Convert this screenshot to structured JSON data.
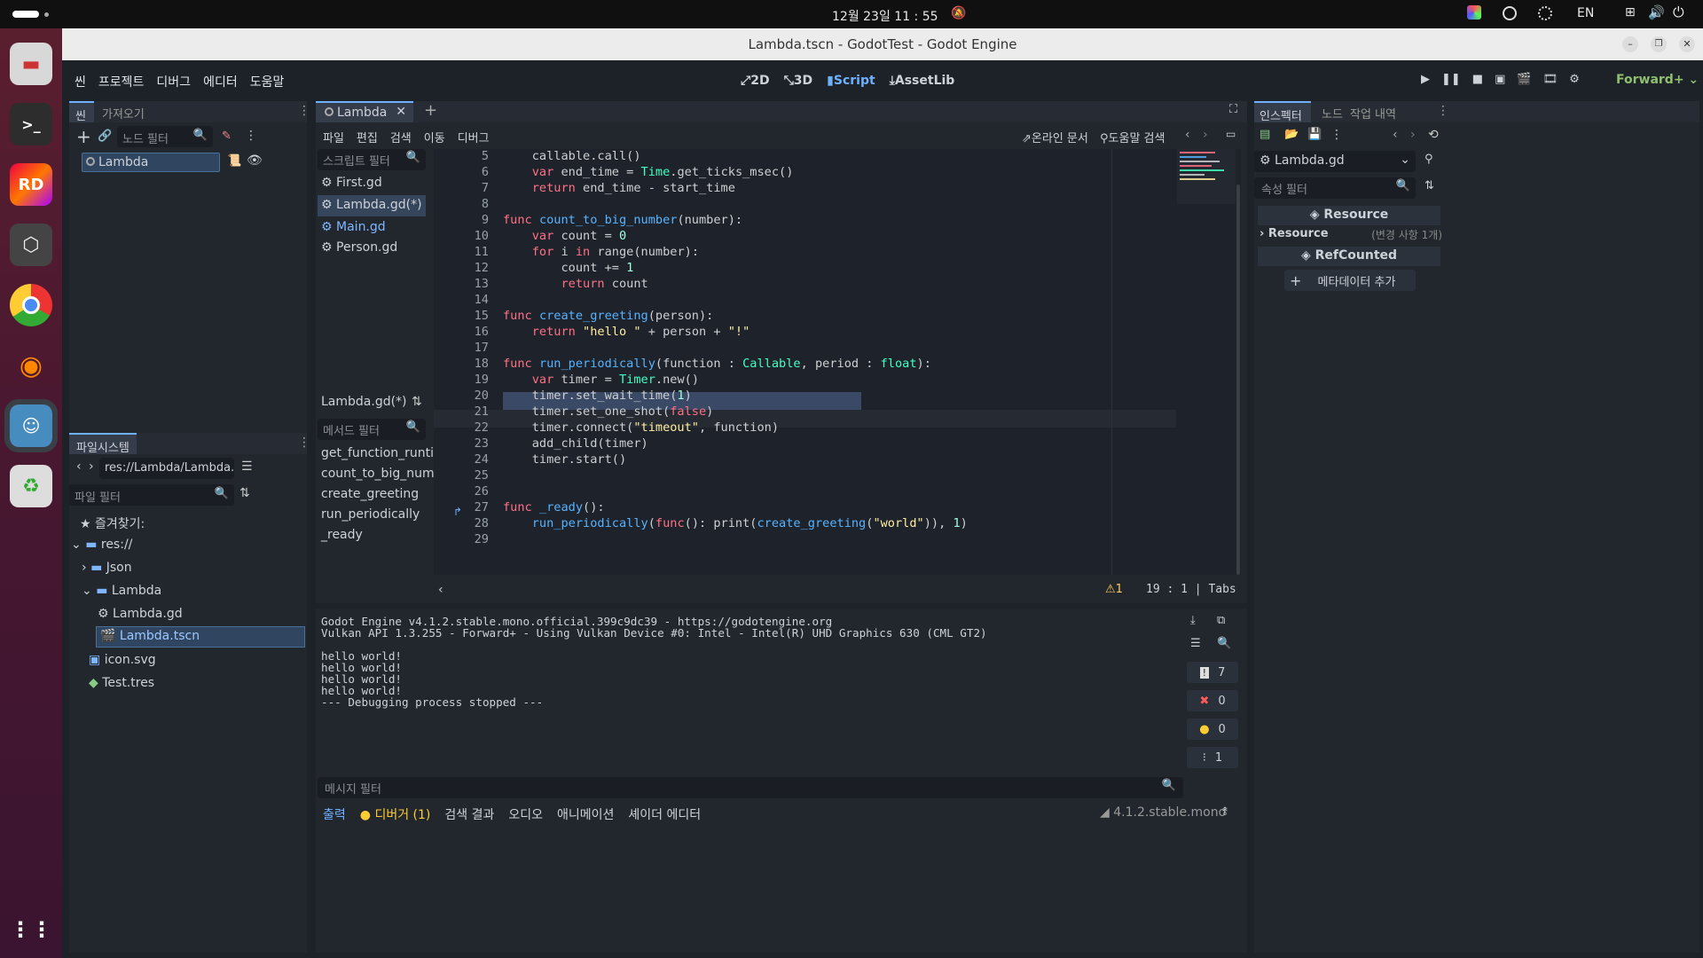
{
  "system": {
    "datetime": "12월 23일  11 : 55",
    "lang": "EN"
  },
  "window": {
    "title": "Lambda.tscn - GodotTest - Godot Engine"
  },
  "menubar": {
    "items": [
      "씬",
      "프로젝트",
      "디버그",
      "에디터",
      "도움말"
    ]
  },
  "workspaces": {
    "w2d": "2D",
    "w3d": "3D",
    "script": "Script",
    "assetlib": "AssetLib"
  },
  "renderer": "Forward+",
  "scene_dock": {
    "tabs": [
      "씬",
      "가져오기"
    ],
    "filter_placeholder": "노드 필터",
    "root_node": "Lambda"
  },
  "filesystem": {
    "tab": "파일시스템",
    "path": "res://Lambda/Lambda.tscn",
    "filter_placeholder": "파일 필터",
    "items": [
      {
        "label": "즐겨찾기:"
      },
      {
        "label": "res://"
      },
      {
        "label": "Json"
      },
      {
        "label": "Lambda"
      },
      {
        "label": "Lambda.gd"
      },
      {
        "label": "Lambda.tscn"
      },
      {
        "label": "icon.svg"
      },
      {
        "label": "Test.tres"
      }
    ]
  },
  "script_editor": {
    "tab": "Lambda",
    "menus": [
      "파일",
      "편집",
      "검색",
      "이동",
      "디버그"
    ],
    "online_docs": "온라인 문서",
    "help_search": "도움말 검색",
    "script_filter": "스크립트 필터",
    "scripts": [
      "First.gd",
      "Lambda.gd(*)",
      "Main.gd",
      "Person.gd"
    ],
    "current_script": "Lambda.gd(*)",
    "method_filter": "메서드 필터",
    "methods": [
      "get_function_runti...",
      "count_to_big_num...",
      "create_greeting",
      "run_periodically",
      "_ready"
    ],
    "status": {
      "warnings": "1",
      "line": "19",
      "sep": ":",
      "col": "1",
      "indent": "| Tabs"
    }
  },
  "code": {
    "lines": [
      {
        "n": "5",
        "t": "    callable.call()"
      },
      {
        "n": "6",
        "t": "    var end_time = Time.get_ticks_msec()"
      },
      {
        "n": "7",
        "t": "    return end_time - start_time"
      },
      {
        "n": "8",
        "t": ""
      },
      {
        "n": "9",
        "t": "func count_to_big_number(number):"
      },
      {
        "n": "10",
        "t": "    var count = 0"
      },
      {
        "n": "11",
        "t": "    for i in range(number):"
      },
      {
        "n": "12",
        "t": "        count += 1"
      },
      {
        "n": "13",
        "t": "        return count"
      },
      {
        "n": "14",
        "t": ""
      },
      {
        "n": "15",
        "t": "func create_greeting(person):"
      },
      {
        "n": "16",
        "t": "    return \"hello \" + person + \"!\""
      },
      {
        "n": "17",
        "t": ""
      },
      {
        "n": "18",
        "t": "func run_periodically(function : Callable, period : float):"
      },
      {
        "n": "19",
        "t": "    var timer = Timer.new()"
      },
      {
        "n": "20",
        "t": "    timer.set_wait_time(1)"
      },
      {
        "n": "21",
        "t": "    timer.set_one_shot(false)"
      },
      {
        "n": "22",
        "t": "    timer.connect(\"timeout\", function)"
      },
      {
        "n": "23",
        "t": "    add_child(timer)"
      },
      {
        "n": "24",
        "t": "    timer.start()"
      },
      {
        "n": "25",
        "t": ""
      },
      {
        "n": "26",
        "t": ""
      },
      {
        "n": "27",
        "t": "func _ready():"
      },
      {
        "n": "28",
        "t": "    run_periodically(func(): print(create_greeting(\"world\")), 1)"
      },
      {
        "n": "29",
        "t": ""
      }
    ]
  },
  "output": {
    "lines": [
      "Godot Engine v4.1.2.stable.mono.official.399c9dc39 - https://godotengine.org",
      "Vulkan API 1.3.255 - Forward+ - Using Vulkan Device #0: Intel - Intel(R) UHD Graphics 630 (CML GT2)",
      "",
      "hello world!",
      "hello world!",
      "hello world!",
      "hello world!",
      "--- Debugging process stopped ---"
    ],
    "filter_placeholder": "메시지 필터",
    "counts": {
      "messages": "7",
      "errors": "0",
      "warnings": "0",
      "editor": "1"
    }
  },
  "bottom_tabs": [
    "출력",
    "디버거 (1)",
    "검색 결과",
    "오디오",
    "애니메이션",
    "셰이더 에디터"
  ],
  "version": "4.1.2.stable.mono",
  "inspector": {
    "tabs": [
      "인스펙터",
      "노드",
      "작업 내역"
    ],
    "object": "Lambda.gd",
    "filter_placeholder": "속성 필터",
    "section_resource": "Resource",
    "resource_row": "Resource",
    "resource_changes": "(변경 사항 1개)",
    "section_refcounted": "RefCounted",
    "add_metadata": "메타데이터 추가"
  }
}
